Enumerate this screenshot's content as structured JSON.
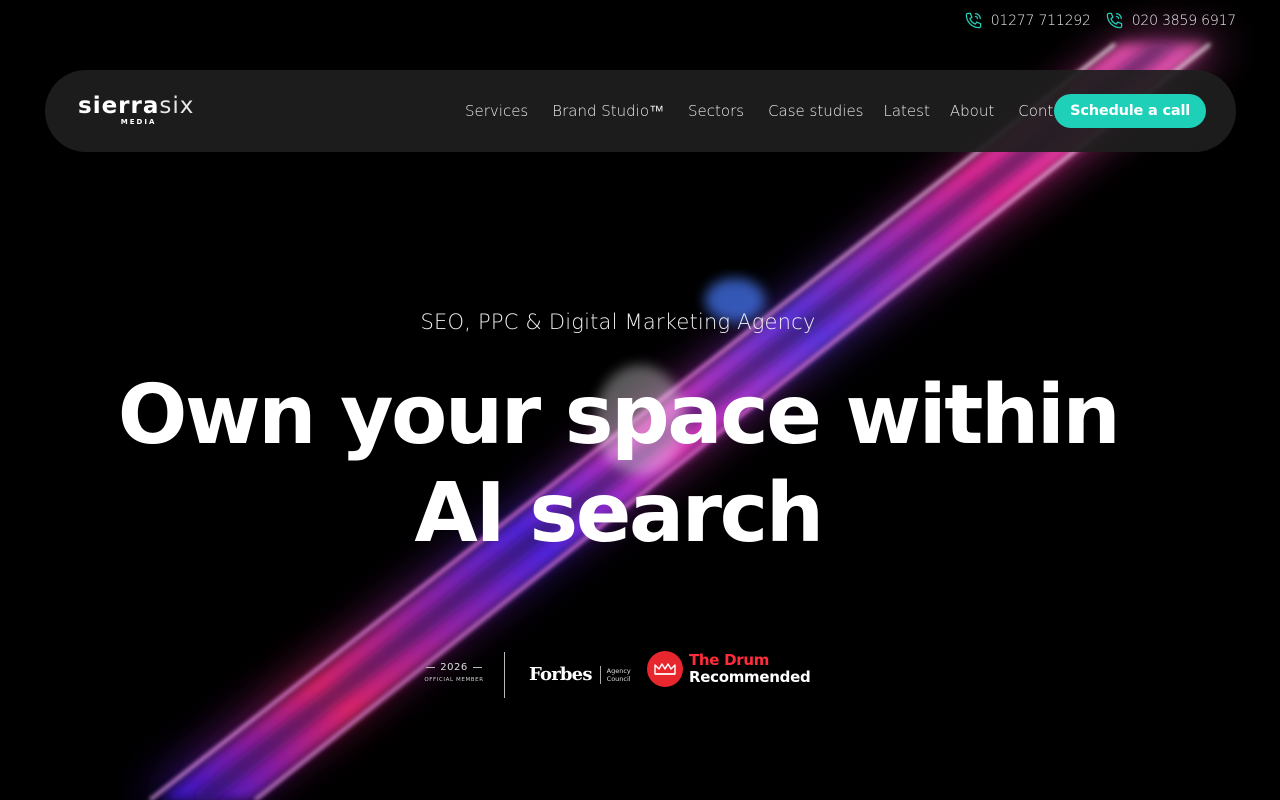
{
  "colors": {
    "background": "#000000",
    "accent": "#1fd0b8",
    "nav_bg": "#1e1e1e",
    "drum_red": "#e8262d"
  },
  "topbar": {
    "phones": [
      {
        "icon": "phone-icon",
        "number": "01277 711292"
      },
      {
        "icon": "phone-icon",
        "number": "020 3859 6917"
      }
    ]
  },
  "nav": {
    "logo": {
      "bold": "sierra",
      "light": "six",
      "sub": "MEDIA"
    },
    "items": [
      "Services",
      "Brand Studio™",
      "Sectors",
      "Case studies",
      "Latest",
      "About",
      "Contact"
    ],
    "cta": "Schedule a call"
  },
  "hero": {
    "eyebrow": "SEO, PPC & Digital Marketing Agency",
    "headline_line1": "Own your space within",
    "headline_line2": "AI search"
  },
  "badges": {
    "official": {
      "year": "2026",
      "label": "OFFICIAL MEMBER"
    },
    "forbes": {
      "word": "Forbes",
      "sub1": "Agency",
      "sub2": "Council"
    },
    "drum": {
      "line1": "The Drum",
      "line2": "Recommended",
      "icon": "crown-icon"
    }
  }
}
